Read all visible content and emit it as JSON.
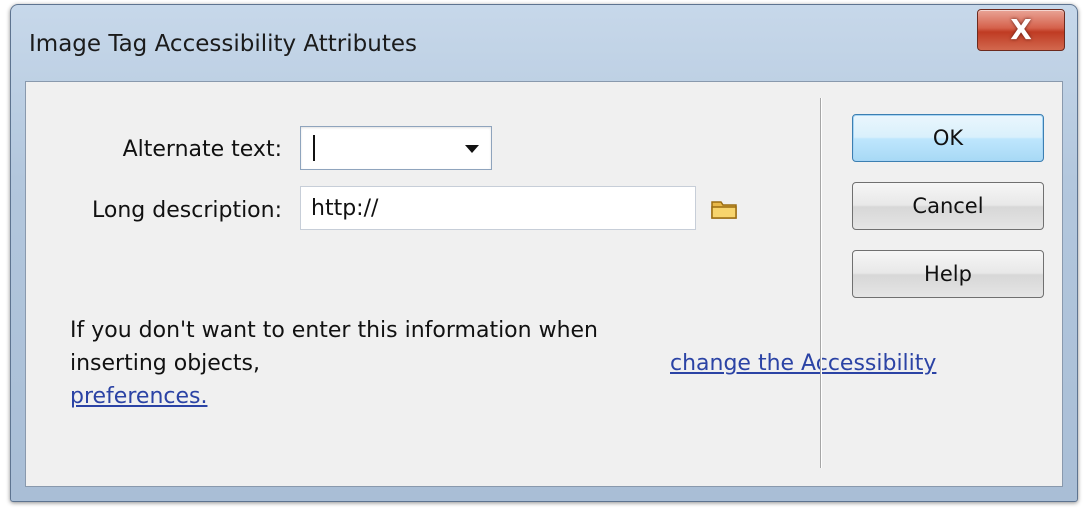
{
  "dialog": {
    "title": "Image Tag Accessibility Attributes",
    "close_label": "X"
  },
  "fields": {
    "alt_text_label": "Alternate text:",
    "alt_text_value": "",
    "long_desc_label": "Long description:",
    "long_desc_value": "http://"
  },
  "info": {
    "text": "If you don't want to enter this information when inserting objects, ",
    "link": "change the Accessibility preferences."
  },
  "buttons": {
    "ok": "OK",
    "cancel": "Cancel",
    "help": "Help"
  },
  "icons": {
    "browse": "folder-icon",
    "dropdown": "chevron-down-icon",
    "close": "close-icon"
  }
}
